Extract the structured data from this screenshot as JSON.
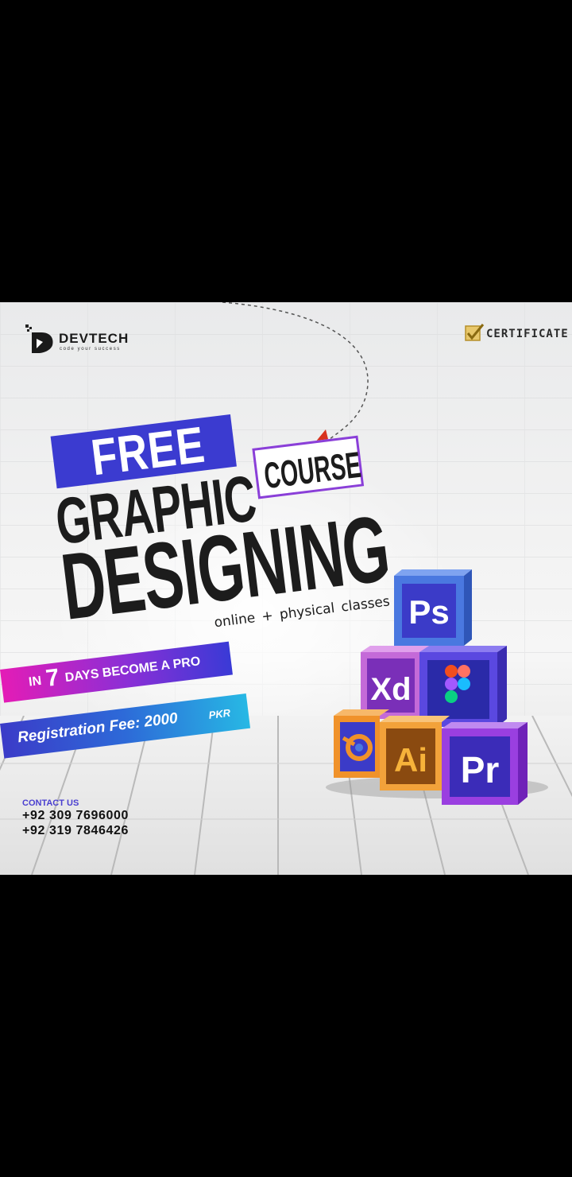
{
  "brand": {
    "name": "DEVTECH",
    "tagline": "code your success"
  },
  "certificate": {
    "label": "CERTIFICATE"
  },
  "headline": {
    "free": "FREE",
    "graphic": "GRAPHIC",
    "course": "COURSE",
    "designing": "DESIGNING",
    "subtitle": "online + physical  classes"
  },
  "promo": {
    "pro_in": "IN",
    "pro_number": "7",
    "pro_rest": "DAYS BECOME A PRO",
    "fee_text": "Registration Fee: 2000",
    "fee_currency": "PKR"
  },
  "contact": {
    "label": "CONTACT US",
    "phones": [
      "+92 309 7696000",
      "+92 319 7846426"
    ]
  },
  "tools": [
    {
      "label": "Ps",
      "icon": "photoshop-icon"
    },
    {
      "label": "Xd",
      "icon": "adobe-xd-icon"
    },
    {
      "label": "figma",
      "icon": "figma-icon"
    },
    {
      "label": "blender",
      "icon": "blender-icon"
    },
    {
      "label": "Ai",
      "icon": "illustrator-icon"
    },
    {
      "label": "Pr",
      "icon": "premiere-icon"
    }
  ],
  "colors": {
    "background": "#000000",
    "brand_blue": "#3b3bd0",
    "accent_purple": "#8a3fd8",
    "magenta": "#e41cb6",
    "cyan": "#27b8e4",
    "arrow_red": "#d8321e"
  }
}
